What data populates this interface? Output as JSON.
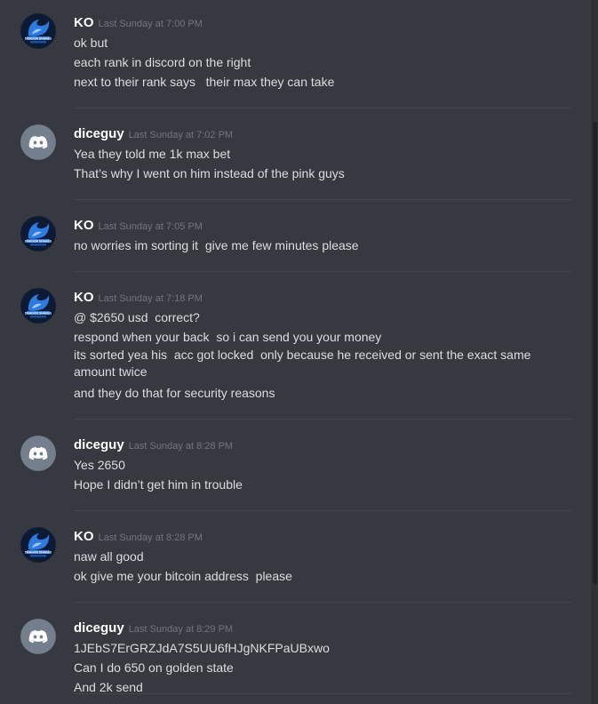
{
  "messages": [
    {
      "author": "KO",
      "avatar": "dragon-logo-avatar",
      "timestamp": "Last Sunday at 7:00 PM",
      "lines": [
        "ok but",
        "each rank in discord on the right",
        "next to their rank says   their max they can take"
      ]
    },
    {
      "author": "diceguy",
      "avatar": "discord-default-avatar",
      "timestamp": "Last Sunday at 7:02 PM",
      "lines": [
        "Yea they told me 1k max bet",
        "That’s why I went on him instead of the pink guys"
      ]
    },
    {
      "author": "KO",
      "avatar": "dragon-logo-avatar",
      "timestamp": "Last Sunday at 7:05 PM",
      "lines": [
        "no worries im sorting it  give me few minutes please"
      ]
    },
    {
      "author": "KO",
      "avatar": "dragon-logo-avatar",
      "timestamp": "Last Sunday at 7:18 PM",
      "lines": [
        "@ $2650 usd  correct?",
        "respond when your back  so i can send you your money",
        "its sorted yea his  acc got locked  only because he received or sent the exact same amount twice",
        "and they do that for security reasons"
      ]
    },
    {
      "author": "diceguy",
      "avatar": "discord-default-avatar",
      "timestamp": "Last Sunday at 8:28 PM",
      "lines": [
        "Yes 2650",
        "Hope I didn’t get him in trouble"
      ]
    },
    {
      "author": "KO",
      "avatar": "dragon-logo-avatar",
      "timestamp": "Last Sunday at 8:28 PM",
      "lines": [
        "naw all good",
        "ok give me your bitcoin address  please"
      ]
    },
    {
      "author": "diceguy",
      "avatar": "discord-default-avatar",
      "timestamp": "Last Sunday at 8:29 PM",
      "lines": [
        "1JEbS7ErGRZJdA7S5UU6fHJgNKFPaUBxwo",
        "Can I do 650 on golden state",
        "And 2k send"
      ]
    }
  ],
  "dragon_logo_text": "DRAGON SNAKES",
  "colors": {
    "background": "#36393f",
    "author": "#ffffff",
    "message_text": "#dcddde",
    "timestamp": "#72767d",
    "default_avatar_bg": "#747f8d"
  }
}
